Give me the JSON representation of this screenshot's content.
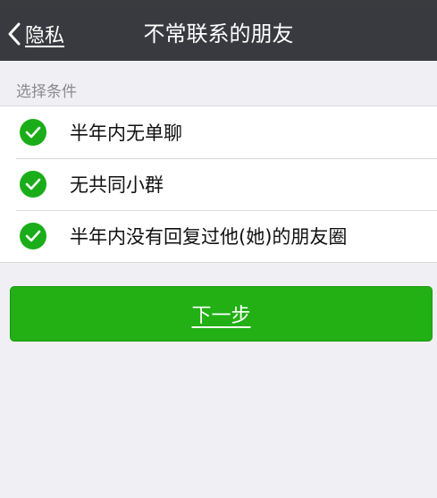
{
  "navbar": {
    "back_label": "隐私",
    "title": "不常联系的朋友"
  },
  "section": {
    "label": "选择条件"
  },
  "options": [
    {
      "label": "半年内无单聊",
      "checked": true
    },
    {
      "label": "无共同小群",
      "checked": true
    },
    {
      "label": "半年内没有回复过他(她)的朋友圈",
      "checked": true
    }
  ],
  "next_button": {
    "label": "下一步"
  },
  "colors": {
    "navbar": "#393a3f",
    "accent": "#1aad19",
    "background": "#efeff4"
  },
  "icons": {
    "back": "chevron-left-icon",
    "check": "checkmark-circle-icon"
  }
}
